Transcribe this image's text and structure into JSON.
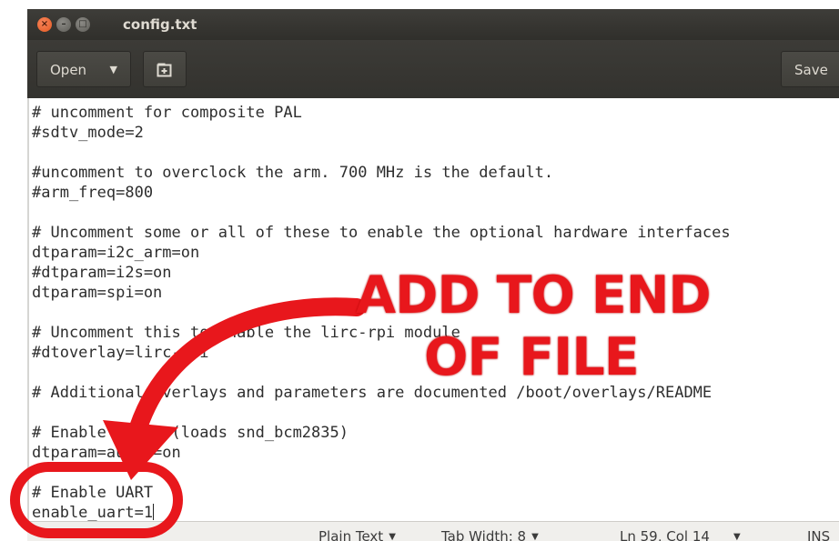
{
  "window": {
    "title": "config.txt",
    "controls": {
      "close": "×",
      "minimize": "–",
      "maximize": "□"
    }
  },
  "toolbar": {
    "open_label": "Open",
    "open_caret": "▼",
    "new_tab_icon": "new-tab-plus-icon",
    "save_label": "Save"
  },
  "editor": {
    "lines": [
      "# uncomment for composite PAL",
      "#sdtv_mode=2",
      "",
      "#uncomment to overclock the arm. 700 MHz is the default.",
      "#arm_freq=800",
      "",
      "# Uncomment some or all of these to enable the optional hardware interfaces",
      "dtparam=i2c_arm=on",
      "#dtparam=i2s=on",
      "dtparam=spi=on",
      "",
      "# Uncomment this to enable the lirc-rpi module",
      "#dtoverlay=lirc-rpi",
      "",
      "# Additional overlays and parameters are documented /boot/overlays/README",
      "",
      "# Enable audio (loads snd_bcm2835)",
      "dtparam=audio=on",
      "",
      "# Enable UART",
      "enable_uart=1"
    ]
  },
  "statusbar": {
    "language": "Plain Text",
    "tab_width": "Tab Width: 8",
    "position": "Ln 59, Col 14",
    "mode": "INS",
    "dropdown_glyph": "▼"
  },
  "annotation": {
    "line1": "ADD TO END",
    "line2": "OF FILE",
    "color": "#e8171c"
  }
}
